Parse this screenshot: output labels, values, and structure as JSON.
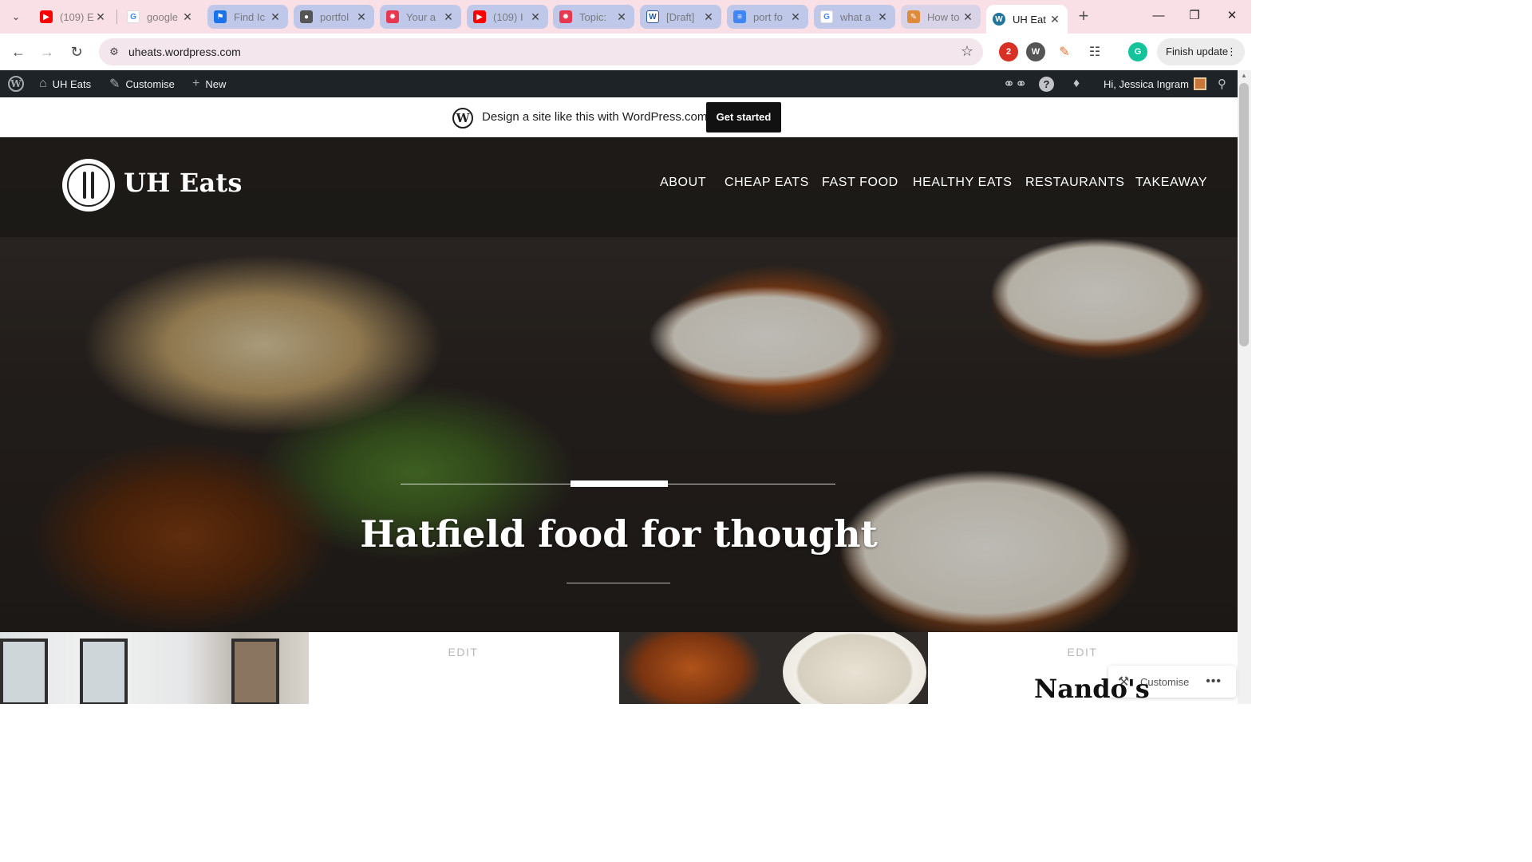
{
  "browser": {
    "tabs": [
      {
        "title": "(109) E",
        "favicon": "youtube-icon",
        "color": "#ff0000"
      },
      {
        "title": "google",
        "favicon": "google-icon",
        "color": "#4285f4"
      },
      {
        "title": "Find Ic",
        "favicon": "flag-icon",
        "color": "#1a73e8"
      },
      {
        "title": "portfol",
        "favicon": "globe-icon",
        "color": "#555555"
      },
      {
        "title": "Your a",
        "favicon": "asana-icon",
        "color": "#e8384f"
      },
      {
        "title": "(109) I",
        "favicon": "youtube-icon",
        "color": "#ff0000"
      },
      {
        "title": "Topic:",
        "favicon": "asana-icon",
        "color": "#e8384f"
      },
      {
        "title": "[Draft]",
        "favicon": "wordsmith-icon",
        "color": "#2b579a"
      },
      {
        "title": "port fo",
        "favicon": "google-docs-icon",
        "color": "#4285f4"
      },
      {
        "title": "what a",
        "favicon": "google-icon",
        "color": "#4285f4"
      },
      {
        "title": "How to",
        "favicon": "brush-icon",
        "color": "#e08a3c"
      },
      {
        "title": "UH Eat",
        "favicon": "wordpress-icon",
        "color": "#21759b"
      }
    ],
    "url": "uheats.wordpress.com",
    "finish_update_label": "Finish update",
    "extension_badge": "2"
  },
  "adminbar": {
    "site_name": "UH Eats",
    "customise": "Customise",
    "new": "New",
    "greeting": "Hi, Jessica Ingram"
  },
  "promo": {
    "text": "Design a site like this with WordPress.com",
    "button": "Get started"
  },
  "site": {
    "title": "UH Eats",
    "nav": [
      "ABOUT",
      "CHEAP EATS",
      "FAST FOOD",
      "HEALTHY EATS",
      "RESTAURANTS",
      "TAKEAWAY"
    ],
    "hero_title": "Hatfield food for thought"
  },
  "posts": {
    "edit_label_1": "EDIT",
    "edit_label_2": "EDIT",
    "visible_title": "Nando's"
  },
  "float": {
    "customise": "Customise"
  }
}
